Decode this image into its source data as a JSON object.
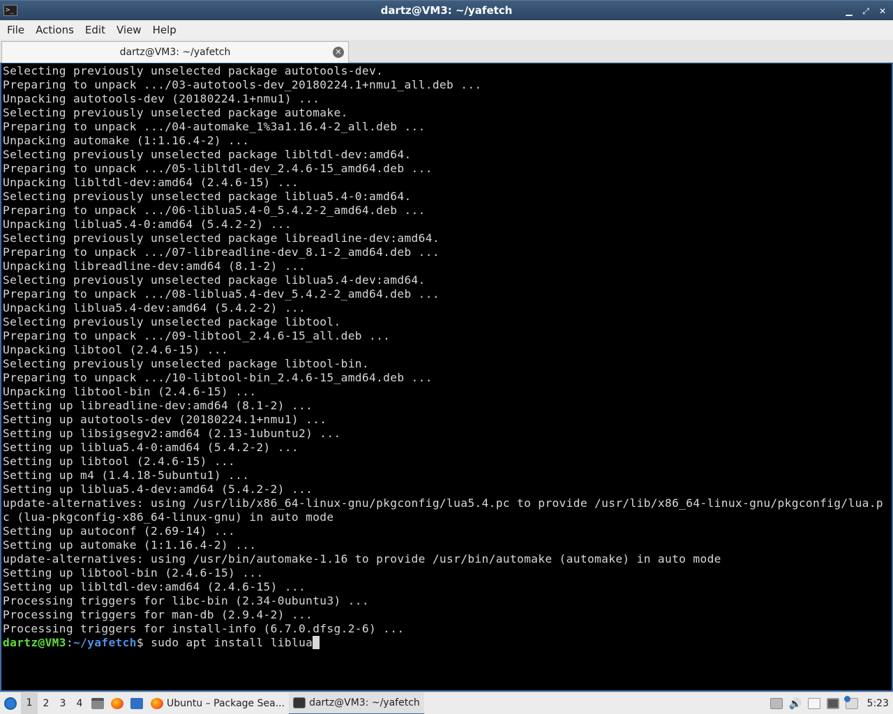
{
  "window": {
    "title": "dartz@VM3: ~/yafetch",
    "controls": {
      "minimize": "▁",
      "maximize": "⤢",
      "close": "✕"
    }
  },
  "menu": [
    "File",
    "Actions",
    "Edit",
    "View",
    "Help"
  ],
  "tab": {
    "label": "dartz@VM3: ~/yafetch",
    "close_icon": "✕"
  },
  "terminal": {
    "lines": [
      "Selecting previously unselected package autotools-dev.",
      "Preparing to unpack .../03-autotools-dev_20180224.1+nmu1_all.deb ...",
      "Unpacking autotools-dev (20180224.1+nmu1) ...",
      "Selecting previously unselected package automake.",
      "Preparing to unpack .../04-automake_1%3a1.16.4-2_all.deb ...",
      "Unpacking automake (1:1.16.4-2) ...",
      "Selecting previously unselected package libltdl-dev:amd64.",
      "Preparing to unpack .../05-libltdl-dev_2.4.6-15_amd64.deb ...",
      "Unpacking libltdl-dev:amd64 (2.4.6-15) ...",
      "Selecting previously unselected package liblua5.4-0:amd64.",
      "Preparing to unpack .../06-liblua5.4-0_5.4.2-2_amd64.deb ...",
      "Unpacking liblua5.4-0:amd64 (5.4.2-2) ...",
      "Selecting previously unselected package libreadline-dev:amd64.",
      "Preparing to unpack .../07-libreadline-dev_8.1-2_amd64.deb ...",
      "Unpacking libreadline-dev:amd64 (8.1-2) ...",
      "Selecting previously unselected package liblua5.4-dev:amd64.",
      "Preparing to unpack .../08-liblua5.4-dev_5.4.2-2_amd64.deb ...",
      "Unpacking liblua5.4-dev:amd64 (5.4.2-2) ...",
      "Selecting previously unselected package libtool.",
      "Preparing to unpack .../09-libtool_2.4.6-15_all.deb ...",
      "Unpacking libtool (2.4.6-15) ...",
      "Selecting previously unselected package libtool-bin.",
      "Preparing to unpack .../10-libtool-bin_2.4.6-15_amd64.deb ...",
      "Unpacking libtool-bin (2.4.6-15) ...",
      "Setting up libreadline-dev:amd64 (8.1-2) ...",
      "Setting up autotools-dev (20180224.1+nmu1) ...",
      "Setting up libsigsegv2:amd64 (2.13-1ubuntu2) ...",
      "Setting up liblua5.4-0:amd64 (5.4.2-2) ...",
      "Setting up libtool (2.4.6-15) ...",
      "Setting up m4 (1.4.18-5ubuntu1) ...",
      "Setting up liblua5.4-dev:amd64 (5.4.2-2) ...",
      "update-alternatives: using /usr/lib/x86_64-linux-gnu/pkgconfig/lua5.4.pc to provide /usr/lib/x86_64-linux-gnu/pkgconfig/lua.p",
      "c (lua-pkgconfig-x86_64-linux-gnu) in auto mode",
      "Setting up autoconf (2.69-14) ...",
      "Setting up automake (1:1.16.4-2) ...",
      "update-alternatives: using /usr/bin/automake-1.16 to provide /usr/bin/automake (automake) in auto mode",
      "Setting up libtool-bin (2.4.6-15) ...",
      "Setting up libltdl-dev:amd64 (2.4.6-15) ...",
      "Processing triggers for libc-bin (2.34-0ubuntu3) ...",
      "Processing triggers for man-db (2.9.4-2) ...",
      "Processing triggers for install-info (6.7.0.dfsg.2-6) ..."
    ],
    "prompt": {
      "user_host": "dartz@VM3",
      "separator": ":",
      "path": "~/yafetch",
      "symbol": "$",
      "command": " sudo apt install liblua"
    },
    "colors": {
      "background": "#000000",
      "text": "#d8d8d8",
      "user": "#5ede3a",
      "path": "#4f8fe6"
    }
  },
  "taskbar": {
    "desktops": [
      "1",
      "2",
      "3",
      "4"
    ],
    "active_desktop": "1",
    "quick_launch": [
      "files-icon",
      "firefox-icon",
      "desktop-icon"
    ],
    "tasks": [
      {
        "label": "Ubuntu – Package Sea...",
        "icon": "firefox-icon",
        "active": false
      },
      {
        "label": "dartz@VM3: ~/yafetch",
        "icon": "terminal-icon",
        "active": true
      }
    ],
    "tray": [
      "storage-icon",
      "volume-icon",
      "clipboard-icon",
      "network-icon",
      "update-notifier-icon"
    ],
    "clock": "5:23"
  }
}
